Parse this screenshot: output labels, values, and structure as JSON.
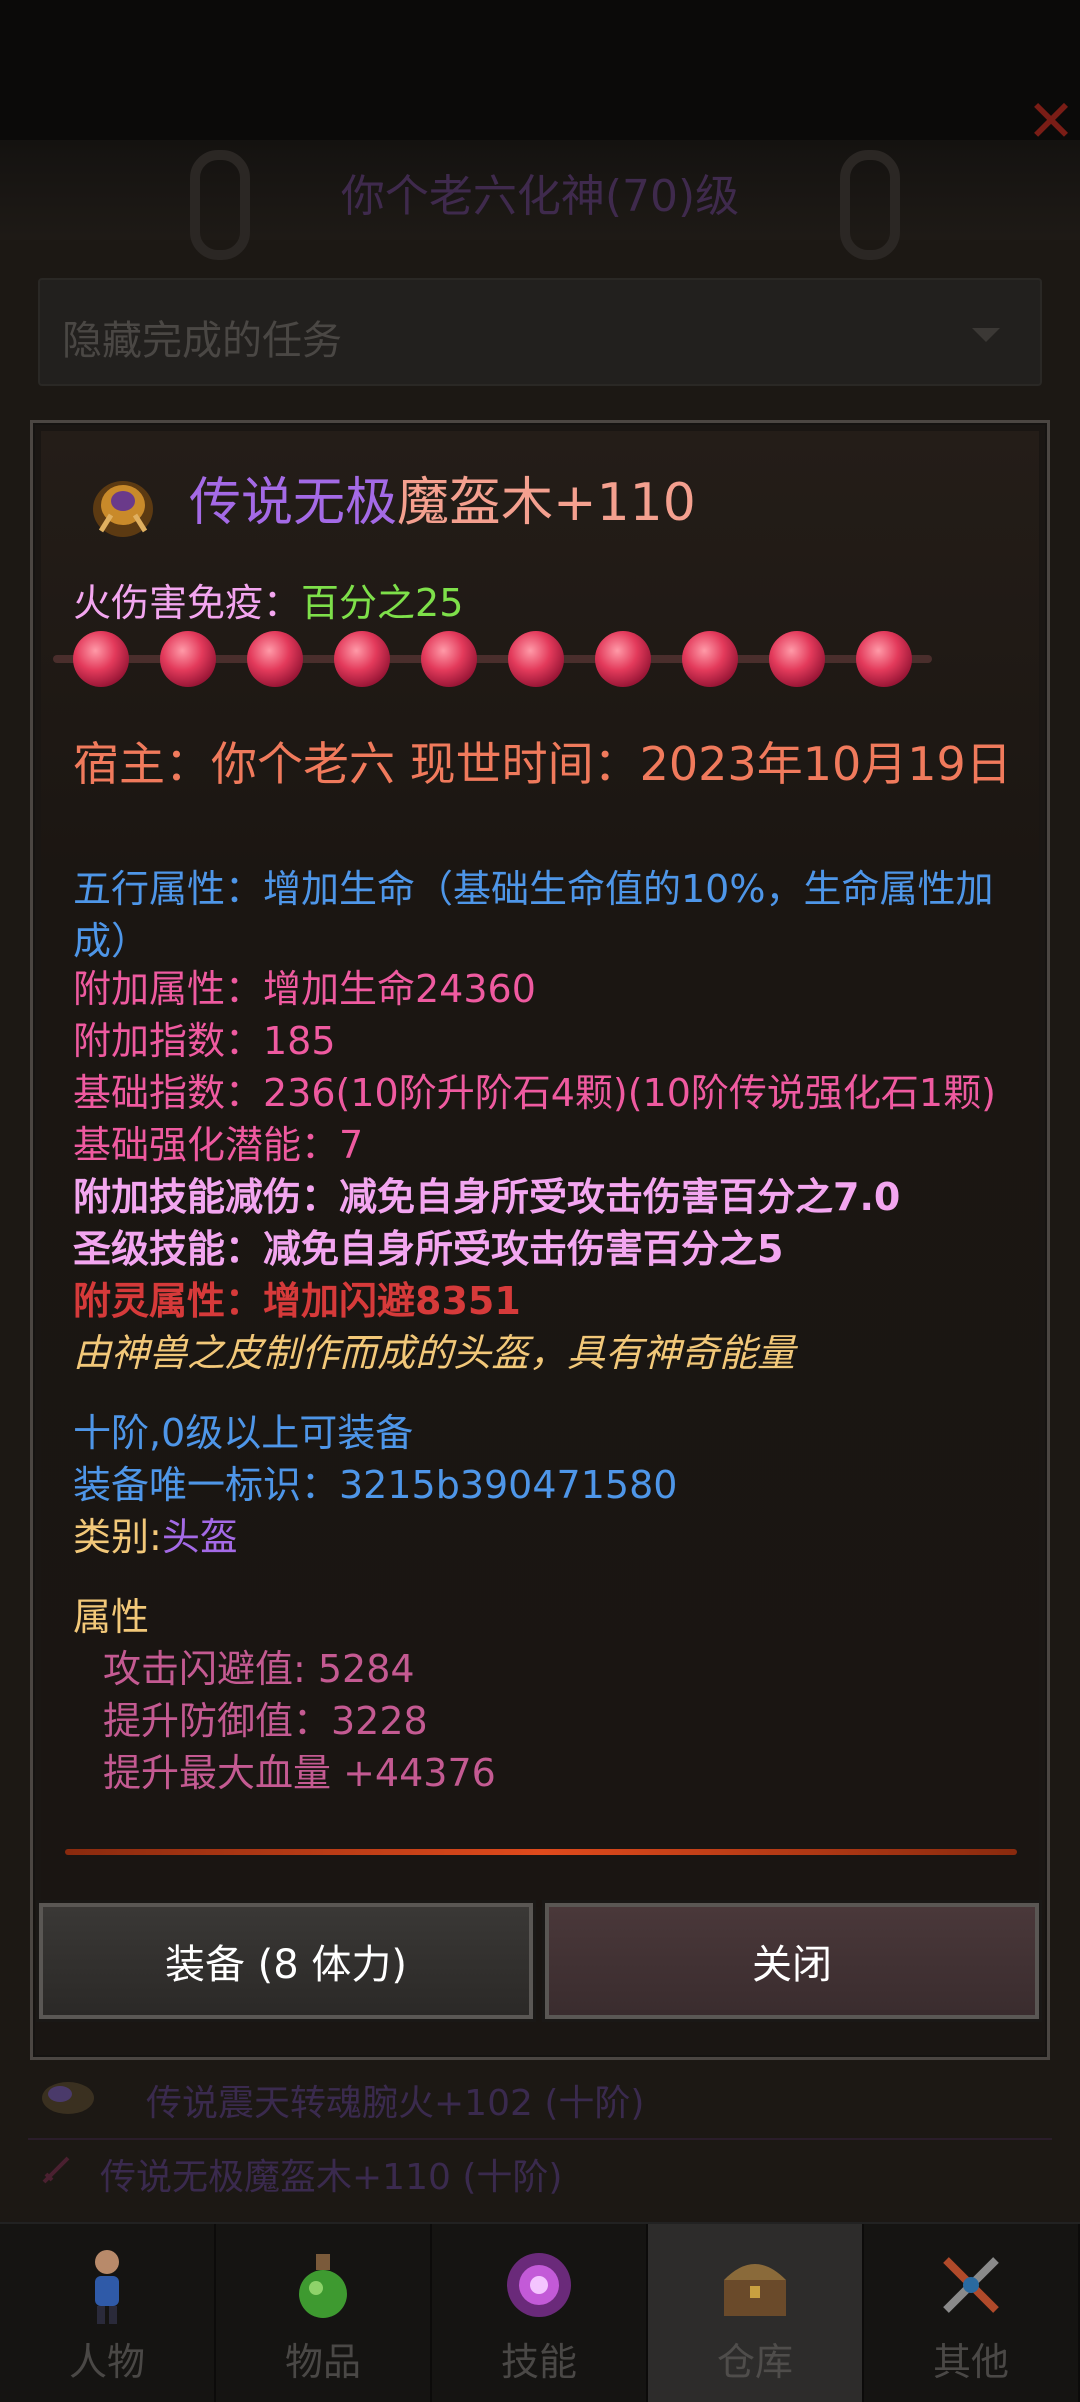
{
  "header": {
    "title": "你个老六化神(70)级"
  },
  "filter": {
    "text": "隐藏完成的任务"
  },
  "item": {
    "title_quality": "传说无极",
    "title_name": "魔盔木+110",
    "immunity_label": "火伤害免疫：",
    "immunity_value": "百分之25",
    "orb_count": 10,
    "host_line": "宿主：你个老六 现世时间：2023年10月19日",
    "wuxing": "五行属性：增加生命（基础生命值的10%，生命属性加成）",
    "extra_attr": "附加属性：增加生命24360",
    "extra_index": "附加指数：185",
    "base_index": "基础指数：236(10阶升阶石4颗)(10阶传说强化石1颗)",
    "base_potential": "基础强化潜能：7",
    "skill_reduce": "附加技能减伤：减免自身所受攻击伤害百分之7.0",
    "holy_skill": "圣级技能：减免自身所受攻击伤害百分之5",
    "spirit_attr": "附灵属性：增加闪避8351",
    "description": "由神兽之皮制作而成的头盔，具有神奇能量",
    "requirement": "十阶,0级以上可装备",
    "unique_id": "装备唯一标识：3215b390471580",
    "category_label": "类别:",
    "category_value": "头盔",
    "attributes_heading": "属性",
    "attributes": [
      "攻击闪避值: 5284",
      "提升防御值：3228",
      "提升最大血量 +44376"
    ]
  },
  "buttons": {
    "equip": "装备 (8 体力)",
    "close": "关闭"
  },
  "list": [
    "传说震天转魂腕火+102 (十阶)",
    "传说无极魔盔木+110 (十阶)"
  ],
  "nav": [
    {
      "label": "人物",
      "icon": "character-icon"
    },
    {
      "label": "物品",
      "icon": "potion-icon"
    },
    {
      "label": "技能",
      "icon": "skill-icon"
    },
    {
      "label": "仓库",
      "icon": "chest-icon"
    },
    {
      "label": "其他",
      "icon": "other-icon"
    }
  ],
  "nav_active": 3,
  "colors": {
    "legend_purple": "#a46ae6",
    "host_orange": "#f07a5c",
    "blue": "#4e96e8",
    "pink": "#ef5aa0",
    "light_pink": "#f3a6f0",
    "red": "#d63a3a",
    "gold": "#f2c879"
  }
}
